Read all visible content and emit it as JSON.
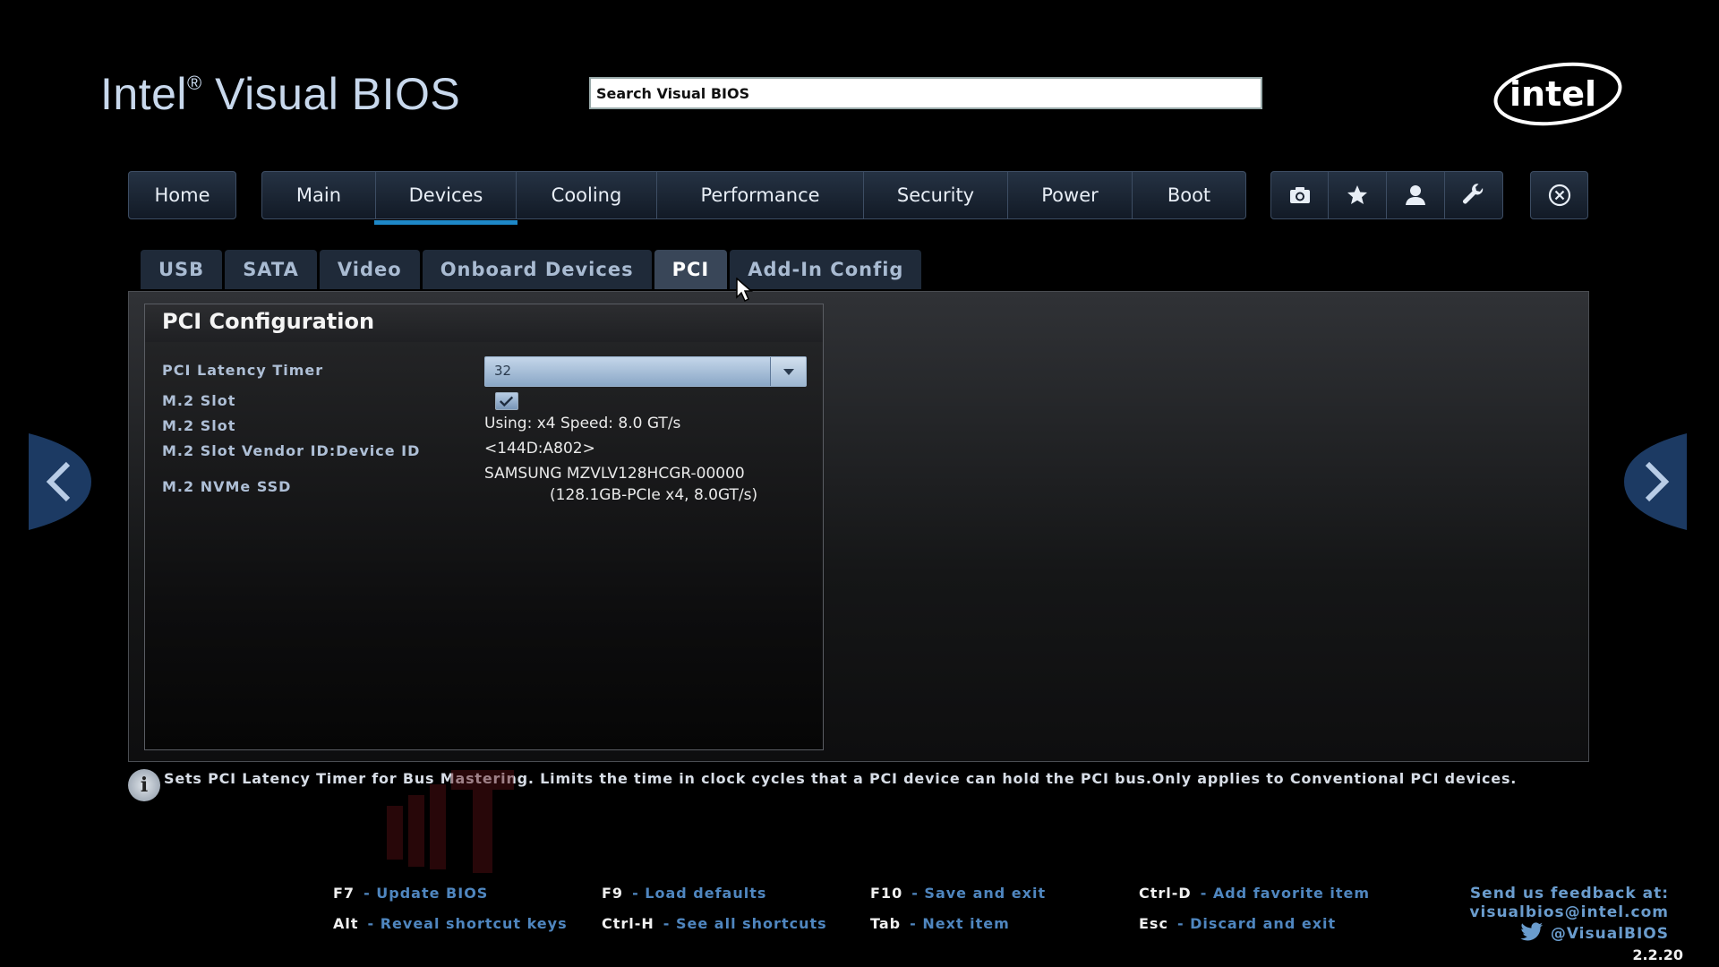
{
  "header": {
    "brand": "Intel",
    "brand_mark": "®",
    "brand_rest": " Visual BIOS",
    "search_placeholder": "Search Visual BIOS",
    "logo": "intel-logo"
  },
  "nav": {
    "home": "Home",
    "tabs": [
      {
        "label": "Main"
      },
      {
        "label": "Devices",
        "active": true
      },
      {
        "label": "Cooling"
      },
      {
        "label": "Performance"
      },
      {
        "label": "Security"
      },
      {
        "label": "Power"
      },
      {
        "label": "Boot"
      }
    ],
    "icons": [
      "camera-icon",
      "star-icon",
      "user-icon",
      "wrench-icon"
    ],
    "close_icon": "close-icon"
  },
  "subtabs": [
    {
      "label": "USB"
    },
    {
      "label": "SATA"
    },
    {
      "label": "Video"
    },
    {
      "label": "Onboard Devices"
    },
    {
      "label": "PCI",
      "active": true
    },
    {
      "label": "Add-In Config"
    }
  ],
  "config": {
    "title": "PCI Configuration",
    "rows": {
      "latency_label": "PCI Latency Timer",
      "latency_value": "32",
      "m2_slot_label": "M.2 Slot",
      "m2_slot_checked": true,
      "m2_slot2_label": "M.2 Slot",
      "m2_slot2_value": "Using: x4  Speed: 8.0 GT/s",
      "vendor_label": "M.2 Slot Vendor ID:Device ID",
      "vendor_value": "<144D:A802>",
      "nvme_label": "M.2 NVMe SSD",
      "nvme_value_1": "SAMSUNG MZVLV128HCGR-00000",
      "nvme_value_2": "(128.1GB-PCIe x4, 8.0GT/s)"
    }
  },
  "info": {
    "icon": "info-icon",
    "text": "Sets PCI Latency Timer for Bus Mastering. Limits the time in clock cycles that a PCI device can hold the PCI bus.Only applies to Conventional PCI devices."
  },
  "shortcuts": [
    {
      "key": "F7",
      "desc": "- Update BIOS"
    },
    {
      "key": "F9",
      "desc": "- Load defaults"
    },
    {
      "key": "F10",
      "desc": "- Save and exit"
    },
    {
      "key": "Ctrl-D",
      "desc": "- Add favorite item"
    },
    {
      "key": "Alt",
      "desc": "- Reveal shortcut keys"
    },
    {
      "key": "Ctrl-H",
      "desc": "- See all shortcuts"
    },
    {
      "key": "Tab",
      "desc": "- Next item"
    },
    {
      "key": "Esc",
      "desc": "- Discard and exit"
    }
  ],
  "feedback": {
    "line1": "Send us feedback at:",
    "line2": "visualbios@intel.com",
    "line3": "@VisualBIOS"
  },
  "version": "2.2.20",
  "colors": {
    "accent": "#1e88c8",
    "label": "#aebfd6",
    "shortcut_desc": "#4f86bf"
  }
}
